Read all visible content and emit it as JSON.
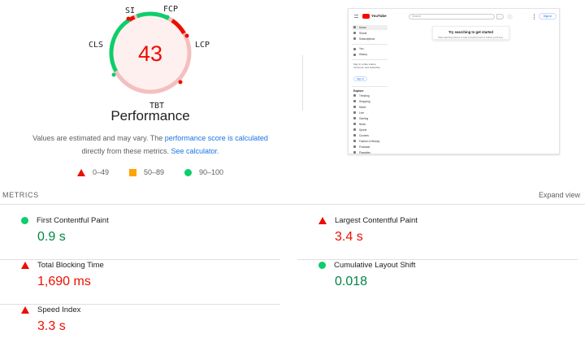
{
  "gauge": {
    "score": "43",
    "score_color": "#eb0f00",
    "labels": {
      "si": "SI",
      "fcp": "FCP",
      "lcp": "LCP",
      "tbt": "TBT",
      "cls": "CLS"
    }
  },
  "performance_title": "Performance",
  "description": {
    "part1": "Values are estimated and may vary. The ",
    "link1": "performance score is calculated",
    "part2": "directly from these metrics. ",
    "link2": "See calculator."
  },
  "legend": [
    {
      "range": "0–49",
      "shape": "triangle",
      "color": "#eb0f00"
    },
    {
      "range": "50–89",
      "shape": "square",
      "color": "#ffa400"
    },
    {
      "range": "90–100",
      "shape": "circle",
      "color": "#0cce6b"
    }
  ],
  "screenshot": {
    "logo_text": "YouTube",
    "search_placeholder": "Search",
    "sign_in": "Sign in",
    "sidebar_items": [
      "Home",
      "Shorts",
      "Subscriptions"
    ],
    "sidebar_items_2": [
      "You",
      "History"
    ],
    "sidebar_note": "Sign in to like videos, comment, and subscribe.",
    "sidebar_sign_in": "Sign in",
    "explore_heading": "Explore",
    "explore_items": [
      "Trending",
      "Shopping",
      "Music",
      "Live",
      "Gaming",
      "News",
      "Sports",
      "Courses",
      "Fashion & Beauty",
      "Podcasts",
      "Playables"
    ],
    "card_title": "Try searching to get started",
    "card_subtitle": "Start watching videos to help us build a feed of videos you'll love."
  },
  "metrics_header": {
    "title": "METRICS",
    "expand": "Expand view"
  },
  "metrics": {
    "fcp": {
      "name": "First Contentful Paint",
      "value": "0.9 s",
      "status": "good"
    },
    "lcp": {
      "name": "Largest Contentful Paint",
      "value": "3.4 s",
      "status": "bad"
    },
    "tbt": {
      "name": "Total Blocking Time",
      "value": "1,690 ms",
      "status": "bad"
    },
    "cls": {
      "name": "Cumulative Layout Shift",
      "value": "0.018",
      "status": "good"
    },
    "si": {
      "name": "Speed Index",
      "value": "3.3 s",
      "status": "bad"
    }
  },
  "colors": {
    "good": "#0cce6b",
    "good_text": "#018642",
    "bad": "#eb0f00",
    "average": "#ffa400",
    "link": "#1a73e8"
  }
}
